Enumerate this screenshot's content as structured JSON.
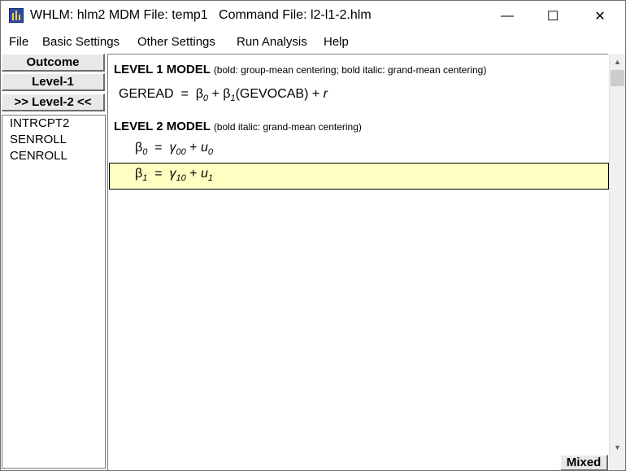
{
  "titlebar": {
    "title": "WHLM: hlm2 MDM File: temp1   Command File: l2-l1-2.hlm",
    "minimize_glyph": "—",
    "maximize_glyph": "☐",
    "close_glyph": "✕"
  },
  "menu": [
    "File",
    "Basic Settings",
    "Other Settings",
    "Run Analysis",
    "Help"
  ],
  "left_panel": {
    "buttons": [
      "Outcome",
      "Level-1",
      ">> Level-2 <<"
    ],
    "variables": [
      "INTRCPT2",
      "SENROLL",
      "CENROLL"
    ]
  },
  "model": {
    "level1_heading": "LEVEL 1 MODEL",
    "level1_note": "(bold: group-mean centering; bold italic: grand-mean centering)",
    "level1_outcome": "GEREAD",
    "level1_predictor": "GEVOCAB",
    "level1_error": "r",
    "level2_heading": "LEVEL 2 MODEL",
    "level2_note": "(bold italic: grand-mean centering)",
    "b0_sub": "0",
    "b1_sub": "1",
    "g00_sub": "00",
    "g10_sub": "10",
    "u0_sub": "0",
    "u1_sub": "1"
  },
  "status": {
    "mode_button": "Mixed"
  }
}
